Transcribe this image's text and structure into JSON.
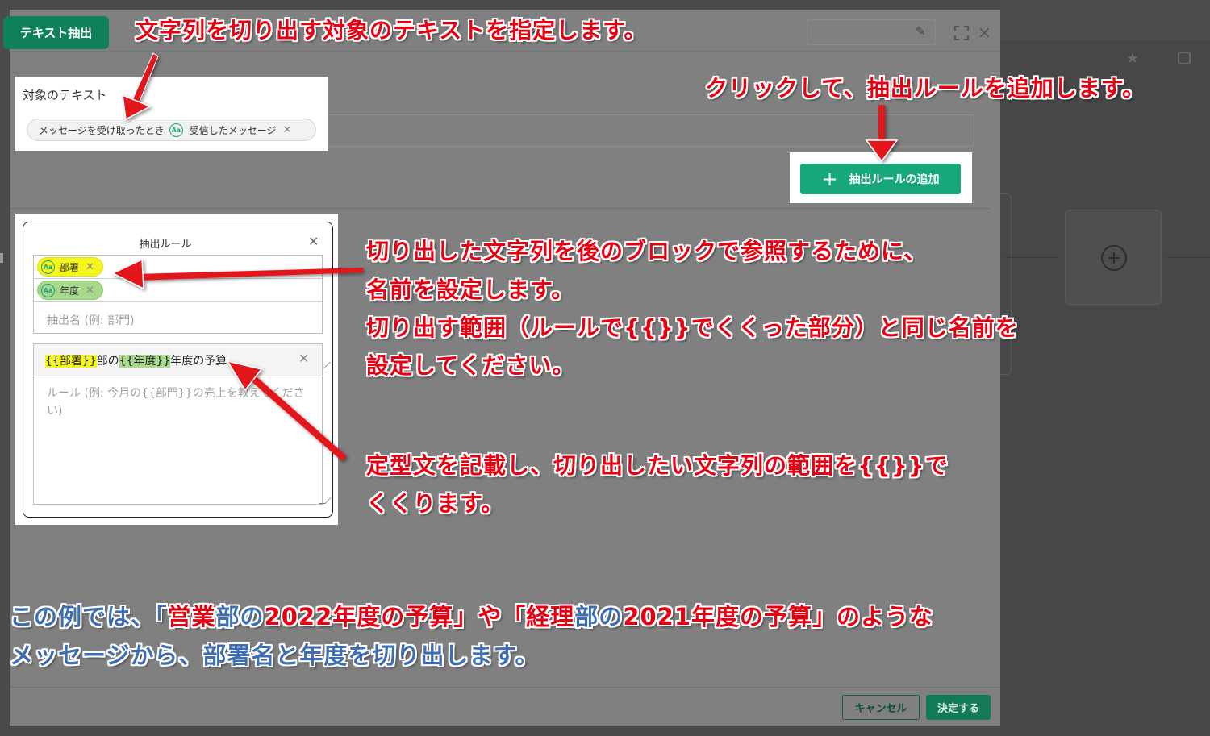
{
  "app": {
    "tab_title": "テキスト抽出"
  },
  "target_text": {
    "label": "対象のテキスト",
    "chip": {
      "source": "メッセージを受け取ったとき",
      "variable": "受信したメッセージ",
      "icon": "text-variable-icon"
    }
  },
  "add_rule_button": {
    "label": "抽出ルールの追加",
    "icon": "plus-icon"
  },
  "extraction_rule": {
    "title": "抽出ルール",
    "names": [
      {
        "label": "部署",
        "color": "#f5f51e"
      },
      {
        "label": "年度",
        "color": "#a7d88b"
      }
    ],
    "name_placeholder": "抽出名 (例: 部門)",
    "rule_parts": [
      "{{部署}}",
      "部の",
      "{{年度}}",
      "年度の予算"
    ],
    "rule_placeholder": "ルール (例: 今月の{{部門}}の売上を教えてください)"
  },
  "footer": {
    "cancel_label": "キャンセル",
    "submit_label": "決定する"
  },
  "annotations": {
    "target": "文字列を切り出す対象のテキストを指定します。",
    "add_rule": "クリックして、抽出ルールを追加します。",
    "names_line1": "切り出した文字列を後のブロックで参照するために、",
    "names_line2": "名前を設定します。",
    "names_line3": "切り出す範囲（ルールで{{}}でくくった部分）と同じ名前を",
    "names_line4": "設定してください。",
    "rule_line1": "定型文を記載し、切り出したい文字列の範囲を{{}}で",
    "rule_line2": "くくります。",
    "example_a": "この例では、「",
    "example_b": "営業",
    "example_c": "部の",
    "example_d": "2022",
    "example_e": "年度の予算」や「",
    "example_f": "経理",
    "example_g": "部の",
    "example_h": "2021",
    "example_i": "年度の予算」のような",
    "example_line2": "メッセージから、部署名と年度を切り出します。"
  },
  "colors": {
    "accent": "#17a77b",
    "annotation_red": "#e60012",
    "annotation_blue": "#3f6eb0"
  }
}
